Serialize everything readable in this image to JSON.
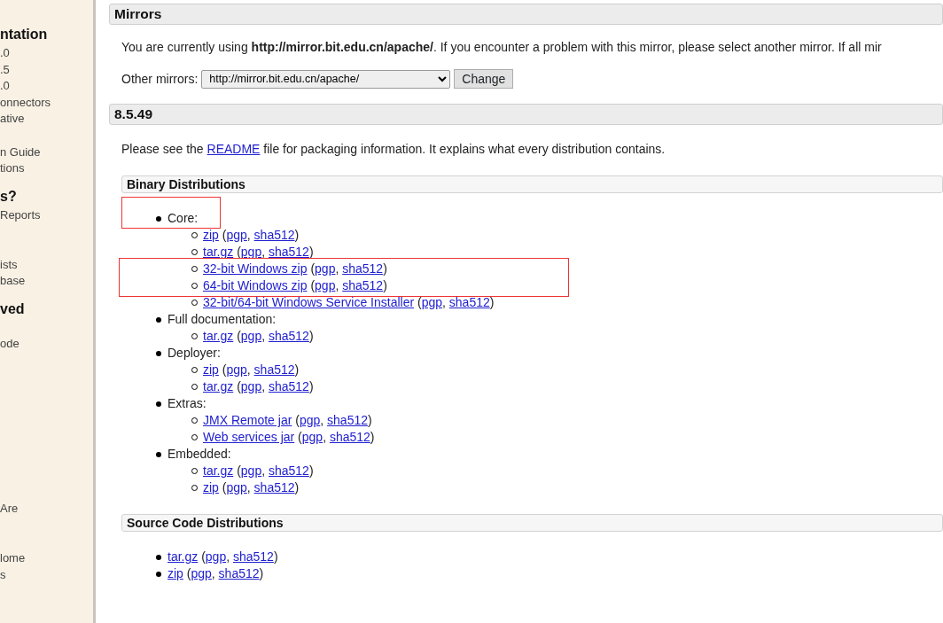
{
  "sidebar": {
    "items": [
      {
        "kind": "heading",
        "text": "ntation"
      },
      {
        "kind": "link",
        "text": ".0"
      },
      {
        "kind": "link",
        "text": ".5"
      },
      {
        "kind": "link",
        "text": ".0"
      },
      {
        "kind": "link",
        "text": "onnectors"
      },
      {
        "kind": "link",
        "text": "ative"
      },
      {
        "kind": "spacer"
      },
      {
        "kind": "link",
        "text": "n Guide"
      },
      {
        "kind": "link",
        "text": "tions"
      },
      {
        "kind": "heading",
        "text": "s?"
      },
      {
        "kind": "link",
        "text": "Reports"
      },
      {
        "kind": "spacer"
      },
      {
        "kind": "spacer"
      },
      {
        "kind": "link",
        "text": "ists"
      },
      {
        "kind": "link",
        "text": "base"
      },
      {
        "kind": "heading",
        "text": "ved"
      },
      {
        "kind": "spacer"
      },
      {
        "kind": "link",
        "text": "ode"
      },
      {
        "kind": "spacer"
      },
      {
        "kind": "spacer"
      },
      {
        "kind": "spacer"
      },
      {
        "kind": "spacer"
      },
      {
        "kind": "spacer"
      },
      {
        "kind": "spacer"
      },
      {
        "kind": "spacer"
      },
      {
        "kind": "spacer"
      },
      {
        "kind": "spacer"
      },
      {
        "kind": "link",
        "text": "Are"
      },
      {
        "kind": "spacer"
      },
      {
        "kind": "spacer"
      },
      {
        "kind": "link",
        "text": "lome"
      },
      {
        "kind": "link",
        "text": "s"
      }
    ]
  },
  "mirrors": {
    "title": "Mirrors",
    "notice": "You are currently using **http://mirror.bit.edu.cn/apache/**. If you encounter a problem with this mirror, please select another mirror. If all mir",
    "select_label": "Other mirrors:",
    "select_value": "http://mirror.bit.edu.cn/apache/",
    "button": "Change"
  },
  "release": {
    "title": "8.5.49",
    "intro": [
      {
        "kind": "text",
        "text": "Please see the "
      },
      {
        "kind": "link",
        "text": "README"
      },
      {
        "kind": "text",
        "text": " file for packaging information. It explains what every distribution contains."
      }
    ],
    "sections": [
      {
        "title": "Binary Distributions",
        "groups": [
          {
            "label": "Core:",
            "boxed": true,
            "entries": [
              {
                "boxed": false,
                "parts": [
                  {
                    "kind": "link",
                    "text": "zip"
                  },
                  {
                    "kind": "text",
                    "text": " ("
                  },
                  {
                    "kind": "link",
                    "text": "pgp"
                  },
                  {
                    "kind": "text",
                    "text": ", "
                  },
                  {
                    "kind": "link",
                    "text": "sha512"
                  },
                  {
                    "kind": "text",
                    "text": ")"
                  }
                ]
              },
              {
                "boxed": false,
                "parts": [
                  {
                    "kind": "link",
                    "text": "tar.gz"
                  },
                  {
                    "kind": "text",
                    "text": " ("
                  },
                  {
                    "kind": "link",
                    "text": "pgp"
                  },
                  {
                    "kind": "text",
                    "text": ", "
                  },
                  {
                    "kind": "link",
                    "text": "sha512"
                  },
                  {
                    "kind": "text",
                    "text": ")"
                  }
                ]
              },
              {
                "boxed": true,
                "parts": [
                  {
                    "kind": "link",
                    "text": "32-bit Windows zip"
                  },
                  {
                    "kind": "text",
                    "text": " ("
                  },
                  {
                    "kind": "link",
                    "text": "pgp"
                  },
                  {
                    "kind": "text",
                    "text": ", "
                  },
                  {
                    "kind": "link",
                    "text": "sha512"
                  },
                  {
                    "kind": "text",
                    "text": ")"
                  }
                ]
              },
              {
                "boxed": true,
                "parts": [
                  {
                    "kind": "link",
                    "text": "64-bit Windows zip"
                  },
                  {
                    "kind": "text",
                    "text": " ("
                  },
                  {
                    "kind": "link",
                    "text": "pgp"
                  },
                  {
                    "kind": "text",
                    "text": ", "
                  },
                  {
                    "kind": "link",
                    "text": "sha512"
                  },
                  {
                    "kind": "text",
                    "text": ")"
                  }
                ]
              },
              {
                "boxed": false,
                "parts": [
                  {
                    "kind": "link",
                    "text": "32-bit/64-bit Windows Service Installer"
                  },
                  {
                    "kind": "text",
                    "text": " ("
                  },
                  {
                    "kind": "link",
                    "text": "pgp"
                  },
                  {
                    "kind": "text",
                    "text": ", "
                  },
                  {
                    "kind": "link",
                    "text": "sha512"
                  },
                  {
                    "kind": "text",
                    "text": ")"
                  }
                ]
              }
            ]
          },
          {
            "label": "Full documentation:",
            "boxed": false,
            "entries": [
              {
                "boxed": false,
                "parts": [
                  {
                    "kind": "link",
                    "text": "tar.gz"
                  },
                  {
                    "kind": "text",
                    "text": " ("
                  },
                  {
                    "kind": "link",
                    "text": "pgp"
                  },
                  {
                    "kind": "text",
                    "text": ", "
                  },
                  {
                    "kind": "link",
                    "text": "sha512"
                  },
                  {
                    "kind": "text",
                    "text": ")"
                  }
                ]
              }
            ]
          },
          {
            "label": "Deployer:",
            "boxed": false,
            "entries": [
              {
                "boxed": false,
                "parts": [
                  {
                    "kind": "link",
                    "text": "zip"
                  },
                  {
                    "kind": "text",
                    "text": " ("
                  },
                  {
                    "kind": "link",
                    "text": "pgp"
                  },
                  {
                    "kind": "text",
                    "text": ", "
                  },
                  {
                    "kind": "link",
                    "text": "sha512"
                  },
                  {
                    "kind": "text",
                    "text": ")"
                  }
                ]
              },
              {
                "boxed": false,
                "parts": [
                  {
                    "kind": "link",
                    "text": "tar.gz"
                  },
                  {
                    "kind": "text",
                    "text": " ("
                  },
                  {
                    "kind": "link",
                    "text": "pgp"
                  },
                  {
                    "kind": "text",
                    "text": ", "
                  },
                  {
                    "kind": "link",
                    "text": "sha512"
                  },
                  {
                    "kind": "text",
                    "text": ")"
                  }
                ]
              }
            ]
          },
          {
            "label": "Extras:",
            "boxed": false,
            "entries": [
              {
                "boxed": false,
                "parts": [
                  {
                    "kind": "link",
                    "text": "JMX Remote jar"
                  },
                  {
                    "kind": "text",
                    "text": " ("
                  },
                  {
                    "kind": "link",
                    "text": "pgp"
                  },
                  {
                    "kind": "text",
                    "text": ", "
                  },
                  {
                    "kind": "link",
                    "text": "sha512"
                  },
                  {
                    "kind": "text",
                    "text": ")"
                  }
                ]
              },
              {
                "boxed": false,
                "parts": [
                  {
                    "kind": "link",
                    "text": "Web services jar"
                  },
                  {
                    "kind": "text",
                    "text": " ("
                  },
                  {
                    "kind": "link",
                    "text": "pgp"
                  },
                  {
                    "kind": "text",
                    "text": ", "
                  },
                  {
                    "kind": "link",
                    "text": "sha512"
                  },
                  {
                    "kind": "text",
                    "text": ")"
                  }
                ]
              }
            ]
          },
          {
            "label": "Embedded:",
            "boxed": false,
            "entries": [
              {
                "boxed": false,
                "parts": [
                  {
                    "kind": "link",
                    "text": "tar.gz"
                  },
                  {
                    "kind": "text",
                    "text": " ("
                  },
                  {
                    "kind": "link",
                    "text": "pgp"
                  },
                  {
                    "kind": "text",
                    "text": ", "
                  },
                  {
                    "kind": "link",
                    "text": "sha512"
                  },
                  {
                    "kind": "text",
                    "text": ")"
                  }
                ]
              },
              {
                "boxed": false,
                "parts": [
                  {
                    "kind": "link",
                    "text": "zip"
                  },
                  {
                    "kind": "text",
                    "text": " ("
                  },
                  {
                    "kind": "link",
                    "text": "pgp"
                  },
                  {
                    "kind": "text",
                    "text": ", "
                  },
                  {
                    "kind": "link",
                    "text": "sha512"
                  },
                  {
                    "kind": "text",
                    "text": ")"
                  }
                ]
              }
            ]
          }
        ]
      },
      {
        "title": "Source Code Distributions",
        "entries": [
          {
            "boxed": false,
            "parts": [
              {
                "kind": "link",
                "text": "tar.gz"
              },
              {
                "kind": "text",
                "text": " ("
              },
              {
                "kind": "link",
                "text": "pgp"
              },
              {
                "kind": "text",
                "text": ", "
              },
              {
                "kind": "link",
                "text": "sha512"
              },
              {
                "kind": "text",
                "text": ")"
              }
            ]
          },
          {
            "boxed": false,
            "parts": [
              {
                "kind": "link",
                "text": "zip"
              },
              {
                "kind": "text",
                "text": " ("
              },
              {
                "kind": "link",
                "text": "pgp"
              },
              {
                "kind": "text",
                "text": ", "
              },
              {
                "kind": "link",
                "text": "sha512"
              },
              {
                "kind": "text",
                "text": ")"
              }
            ]
          }
        ]
      }
    ]
  }
}
